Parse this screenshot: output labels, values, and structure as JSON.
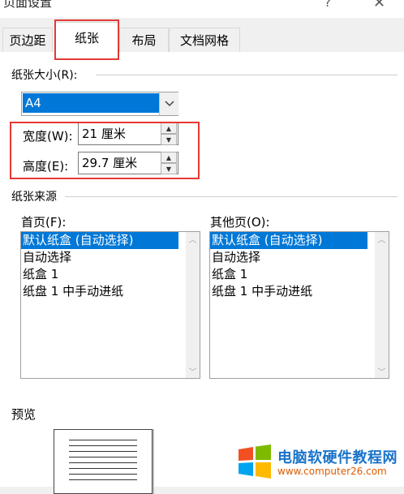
{
  "window": {
    "title": "页面设置",
    "help_label": "?",
    "close_label": "✕"
  },
  "tabs": [
    {
      "label": "页边距",
      "active": false
    },
    {
      "label": "纸张",
      "active": true
    },
    {
      "label": "布局",
      "active": false
    },
    {
      "label": "文档网格",
      "active": false
    }
  ],
  "paper_size": {
    "group_label": "纸张大小(R):",
    "selected": "A4",
    "dropdown_icon": "chevron-down-icon"
  },
  "width": {
    "label": "宽度(W):",
    "value": "21 厘米"
  },
  "height": {
    "label": "高度(E):",
    "value": "29.7 厘米"
  },
  "paper_source": {
    "group_label": "纸张来源",
    "first_page": {
      "label": "首页(F):",
      "items": [
        "默认纸盒 (自动选择)",
        "自动选择",
        "纸盒 1",
        "纸盘 1 中手动进纸"
      ],
      "selected_index": 0
    },
    "other_pages": {
      "label": "其他页(O):",
      "items": [
        "默认纸盒 (自动选择)",
        "自动选择",
        "纸盒 1",
        "纸盘 1 中手动进纸"
      ],
      "selected_index": 0
    }
  },
  "preview": {
    "label": "预览"
  },
  "watermark": {
    "line1": "电脑软硬件教程网",
    "line2": "www.computer26.com",
    "colors": [
      "#f25022",
      "#7fba00",
      "#00a4ef",
      "#ffb900"
    ]
  },
  "colors": {
    "accent": "#0078d7",
    "highlight_box": "#e53935"
  }
}
